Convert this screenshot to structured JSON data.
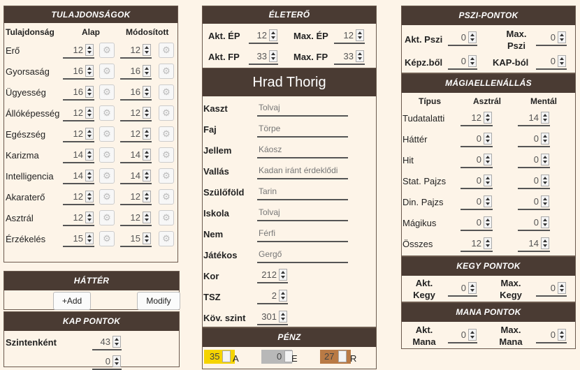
{
  "attributes": {
    "title": "TULAJDONSÁGOK",
    "col_name": "Tulajdonság",
    "col_base": "Alap",
    "col_mod": "Módosított",
    "rows": [
      {
        "name": "Erő",
        "base": "12",
        "mod": "12"
      },
      {
        "name": "Gyorsaság",
        "base": "16",
        "mod": "16"
      },
      {
        "name": "Ügyesség",
        "base": "16",
        "mod": "16"
      },
      {
        "name": "Állóképesség",
        "base": "12",
        "mod": "12"
      },
      {
        "name": "Egészség",
        "base": "12",
        "mod": "12"
      },
      {
        "name": "Karizma",
        "base": "14",
        "mod": "14"
      },
      {
        "name": "Intelligencia",
        "base": "14",
        "mod": "14"
      },
      {
        "name": "Akaraterő",
        "base": "12",
        "mod": "12"
      },
      {
        "name": "Asztrál",
        "base": "12",
        "mod": "12"
      },
      {
        "name": "Érzékelés",
        "base": "15",
        "mod": "15"
      }
    ]
  },
  "background": {
    "title": "HÁTTÉR",
    "add_label": "+Add",
    "modify_label": "Modify"
  },
  "kap": {
    "title": "KAP PONTOK",
    "per_level_label": "Szintenként",
    "per_level_value": "43",
    "next_value": "0"
  },
  "life": {
    "title": "ÉLETERŐ",
    "akt_ep_label": "Akt. ÉP",
    "akt_ep": "12",
    "max_ep_label": "Max. ÉP",
    "max_ep": "12",
    "akt_fp_label": "Akt. FP",
    "akt_fp": "33",
    "max_fp_label": "Max. FP",
    "max_fp": "33"
  },
  "character": {
    "name": "Hrad Thorig",
    "fields": [
      {
        "label": "Kaszt",
        "value": "Tolvaj"
      },
      {
        "label": "Faj",
        "value": "Törpe"
      },
      {
        "label": "Jellem",
        "value": "Káosz"
      },
      {
        "label": "Vallás",
        "value": "Kadan iránt érdeklődi"
      },
      {
        "label": "Szülőföld",
        "value": "Tarin"
      },
      {
        "label": "Iskola",
        "value": "Tolvaj"
      },
      {
        "label": "Nem",
        "value": "Férfi"
      },
      {
        "label": "Játékos",
        "value": "Gergő"
      }
    ],
    "age_label": "Kor",
    "age": "212",
    "tsz_label": "TSZ",
    "tsz": "2",
    "next_level_label": "Köv. szint",
    "next_level": "301"
  },
  "money": {
    "title": "PÉNZ",
    "gold": "35",
    "gold_unit": "A",
    "silver": "0",
    "silver_unit": "E",
    "copper": "27",
    "copper_unit": "R",
    "gold_color": "#f5d400",
    "silver_color": "#b8b8b8",
    "copper_color": "#b97a45"
  },
  "psi": {
    "title": "PSZI-PONTOK",
    "akt_label": "Akt. Pszi",
    "akt": "0",
    "max_label": "Max. Pszi",
    "max": "0",
    "kepz_label": "Képz.ből",
    "kepz": "0",
    "kap_label": "KAP-ból",
    "kap": "0"
  },
  "magic_resist": {
    "title": "MÁGIAELLENÁLLÁS",
    "col_type": "Típus",
    "col_astral": "Asztrál",
    "col_mental": "Mentál",
    "rows": [
      {
        "name": "Tudatalatti",
        "astral": "12",
        "mental": "14"
      },
      {
        "name": "Háttér",
        "astral": "0",
        "mental": "0"
      },
      {
        "name": "Hit",
        "astral": "0",
        "mental": "0"
      },
      {
        "name": "Stat. Pajzs",
        "astral": "0",
        "mental": "0"
      },
      {
        "name": "Din. Pajzs",
        "astral": "0",
        "mental": "0"
      },
      {
        "name": "Mágikus",
        "astral": "0",
        "mental": "0"
      },
      {
        "name": "Összes",
        "astral": "12",
        "mental": "14"
      }
    ]
  },
  "kegy": {
    "title": "KEGY PONTOK",
    "akt_label": "Akt. Kegy",
    "akt": "0",
    "max_label": "Max. Kegy",
    "max": "0"
  },
  "mana": {
    "title": "MANA PONTOK",
    "akt_label": "Akt. Mana",
    "akt": "0",
    "max_label": "Max. Mana",
    "max": "0"
  },
  "colors": {
    "header_bg": "#4a3b33",
    "page_bg": "#fdf4e8"
  }
}
